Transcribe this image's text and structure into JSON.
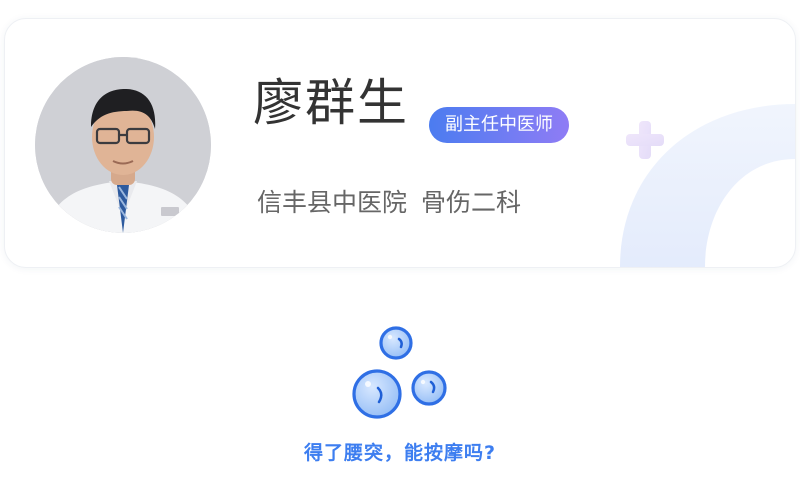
{
  "doctor": {
    "name": "廖群生",
    "title_badge": "副主任中医师",
    "hospital": "信丰县中医院",
    "department": "骨伤二科"
  },
  "question": {
    "text": "得了腰突，能按摩吗?"
  },
  "colors": {
    "accent_blue": "#3d7ef0",
    "badge_gradient_start": "#4b7cf0",
    "badge_gradient_end": "#8f7cf5",
    "name_text": "#333333",
    "secondary_text": "#666666"
  },
  "icons": {
    "avatar": "doctor-portrait",
    "illustration": "bubbles-icon",
    "decor": "plus-icon"
  }
}
